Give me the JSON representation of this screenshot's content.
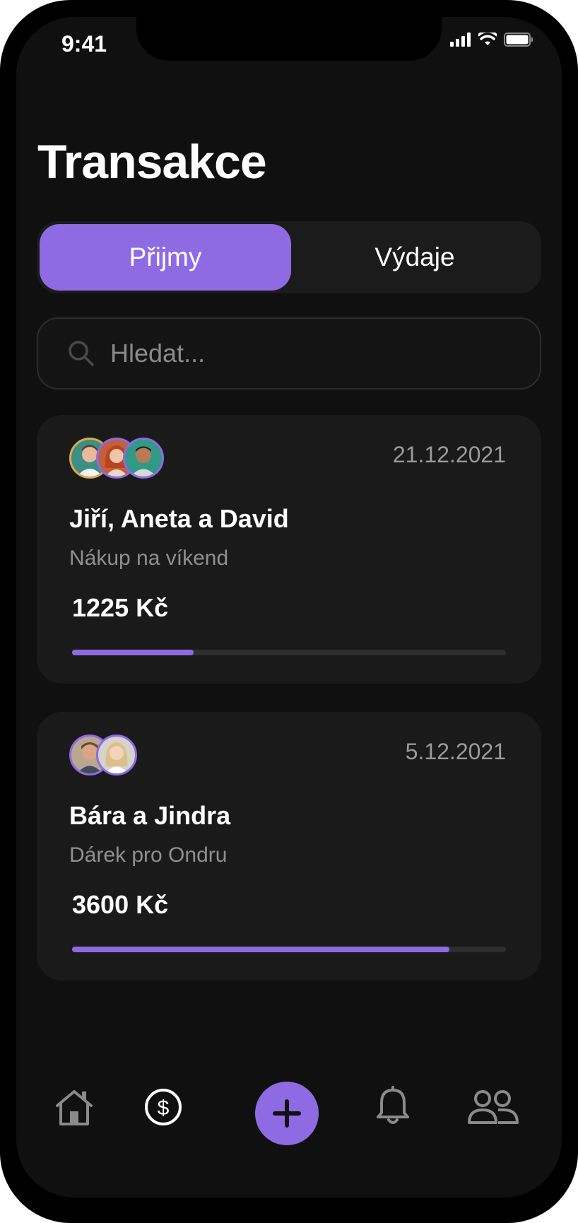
{
  "status_bar": {
    "time": "9:41"
  },
  "page_title": "Transakce",
  "segmented": {
    "left": "Přijmy",
    "right": "Výdaje"
  },
  "search": {
    "placeholder": "Hledat..."
  },
  "transactions": [
    {
      "date": "21.12.2021",
      "name": "Jiří, Aneta a David",
      "description": "Nákup na víkend",
      "amount": "1225 Kč",
      "progress": 0.28
    },
    {
      "date": "5.12.2021",
      "name": "Bára a Jindra",
      "description": "Dárek pro Ondru",
      "amount": "3600 Kč",
      "progress": 0.87
    }
  ],
  "tabbar": {
    "items": [
      "home-icon",
      "dollar-icon",
      "plus-icon",
      "bell-icon",
      "users-icon"
    ]
  },
  "colors": {
    "accent": "#8e6ae3",
    "background": "#101010",
    "card": "#1a1a1a"
  }
}
